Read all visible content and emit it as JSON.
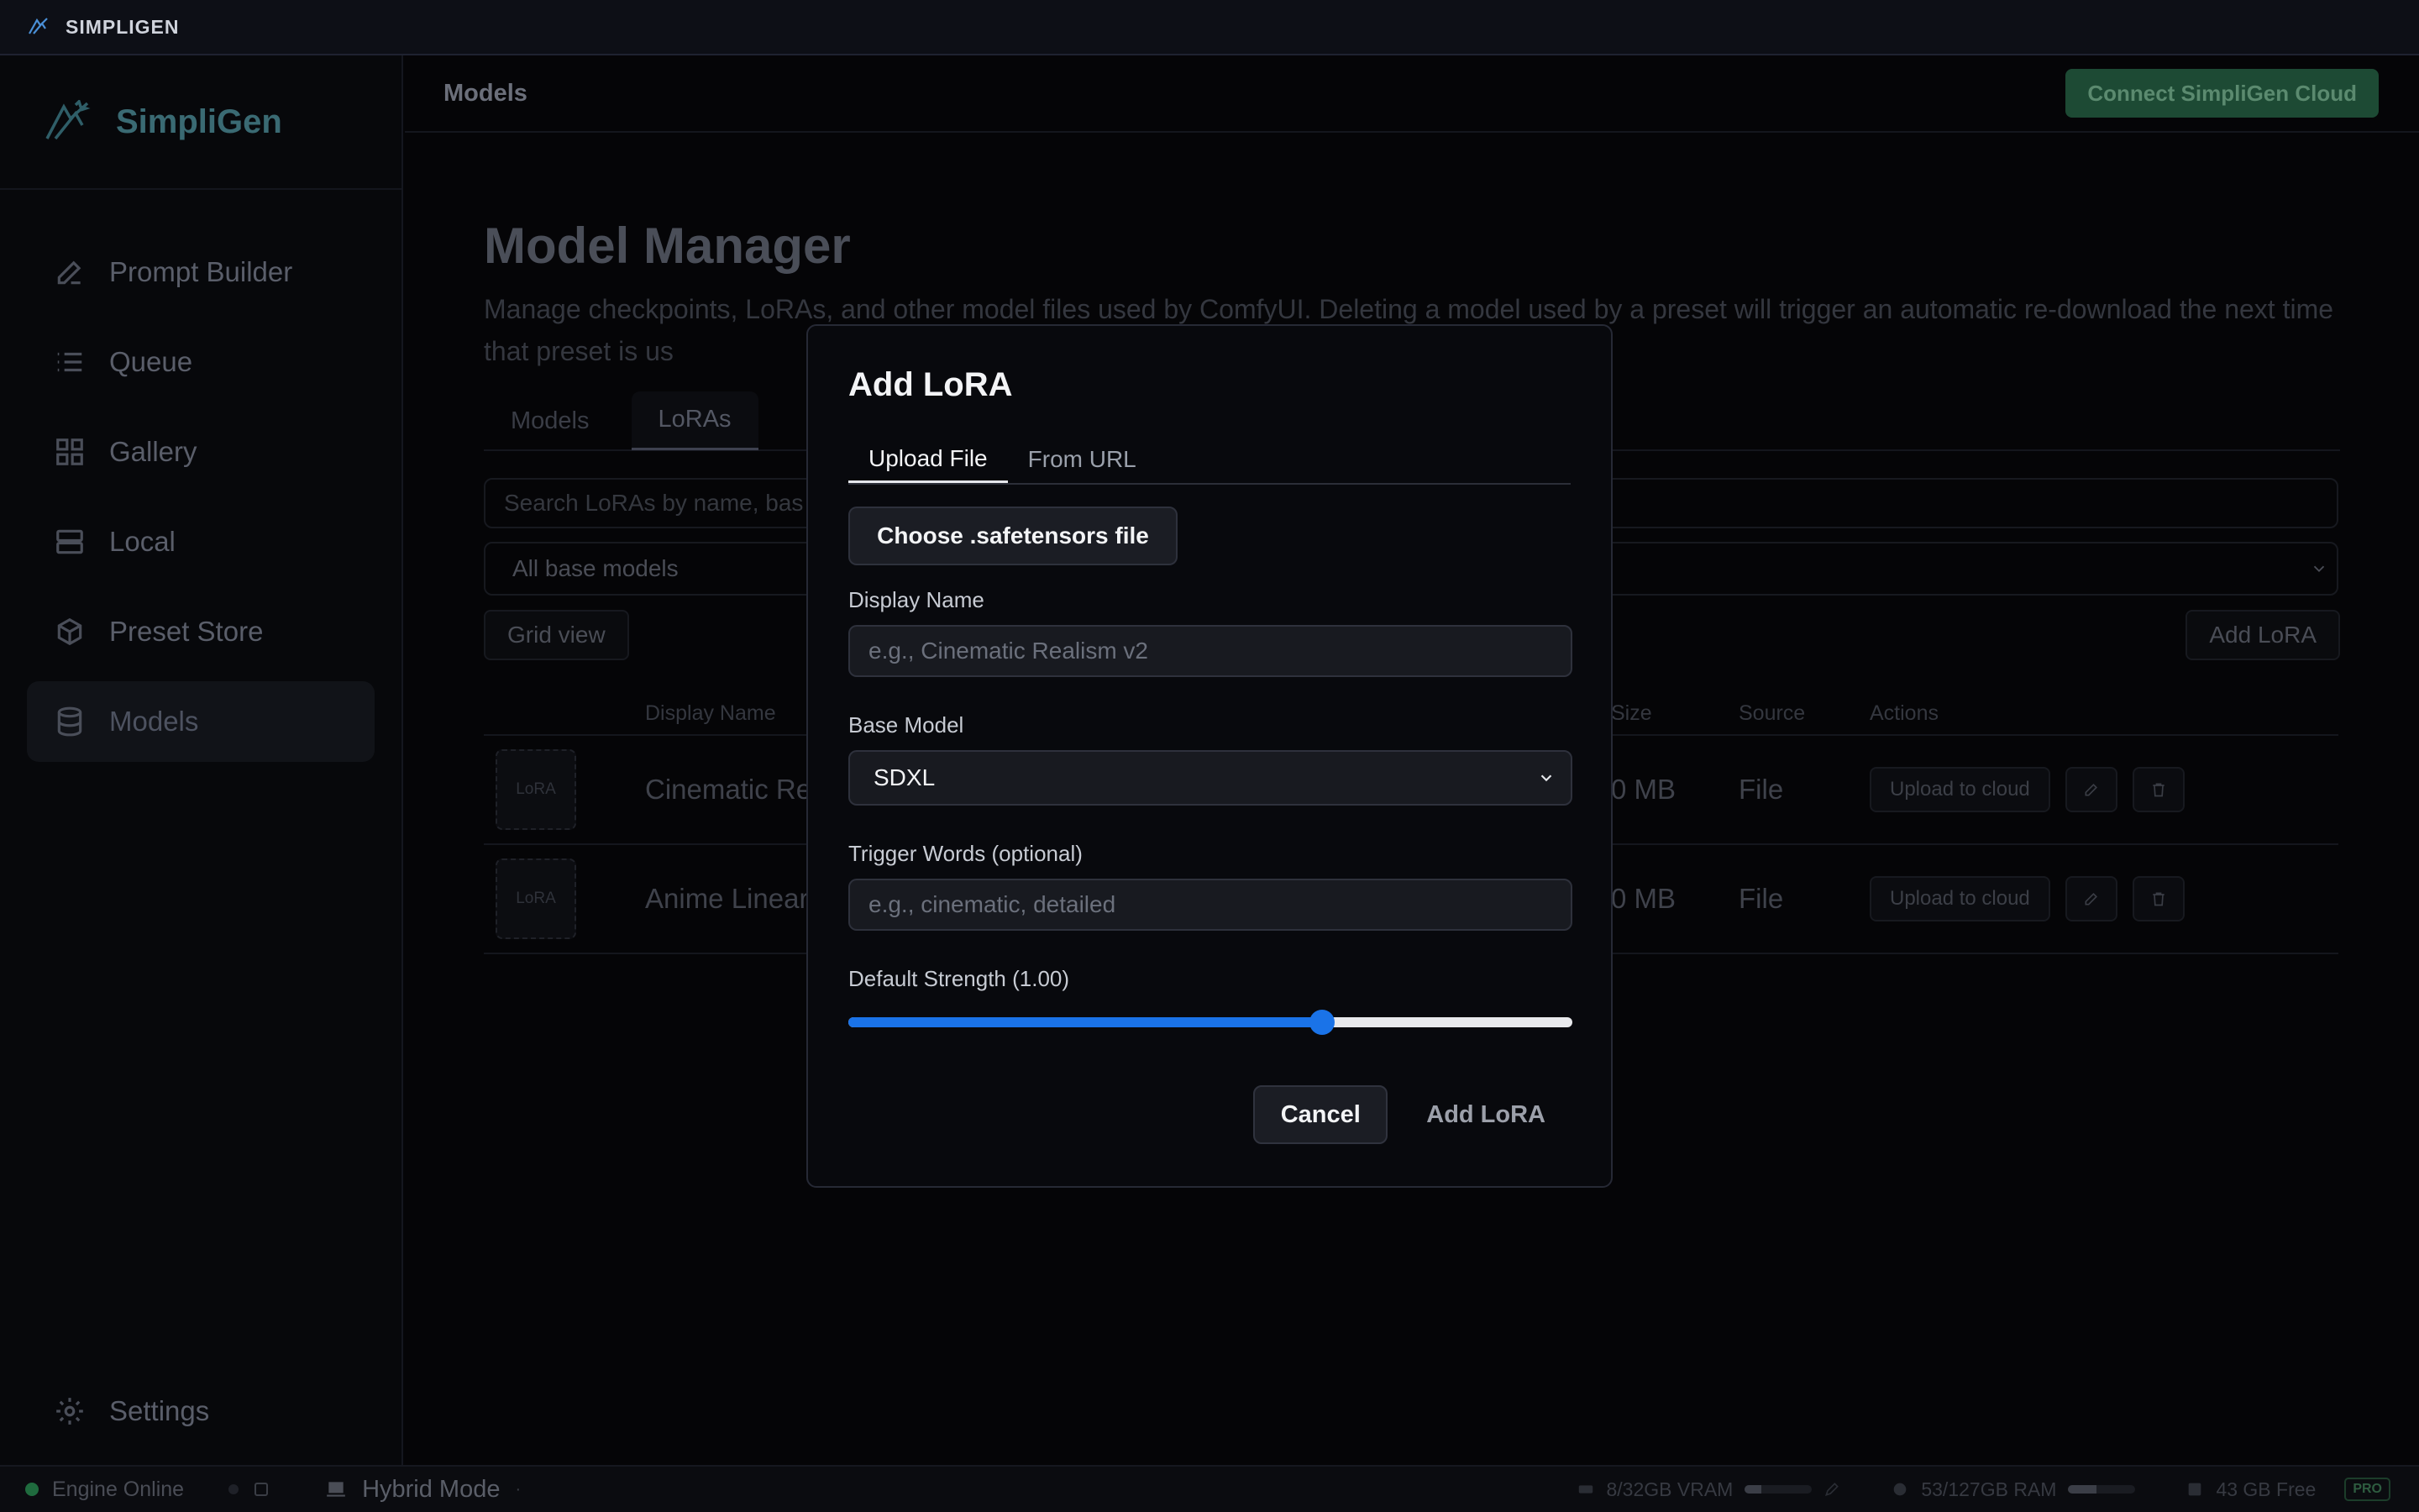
{
  "app": {
    "titlebar_name": "SIMPLIGEN",
    "brand_name": "SimpliGen"
  },
  "sidebar": {
    "items": [
      {
        "label": "Prompt Builder",
        "icon": "pencil-icon"
      },
      {
        "label": "Queue",
        "icon": "list-icon"
      },
      {
        "label": "Gallery",
        "icon": "grid-icon"
      },
      {
        "label": "Local",
        "icon": "server-icon"
      },
      {
        "label": "Preset Store",
        "icon": "package-icon"
      },
      {
        "label": "Models",
        "icon": "database-icon",
        "active": true
      }
    ],
    "settings_label": "Settings"
  },
  "header": {
    "crumb": "Models",
    "cloud_button": "Connect SimpliGen Cloud"
  },
  "main": {
    "title": "Model Manager",
    "description": "Manage checkpoints, LoRAs, and other model files used by ComfyUI. Deleting a model used by a preset will trigger an automatic re-download the next time that preset is us",
    "tabs": [
      "Models",
      "LoRAs"
    ],
    "active_tab": "LoRAs",
    "search_placeholder": "Search LoRAs by name, bas",
    "filter_value": "All base models",
    "grid_view_label": "Grid view",
    "add_lora_label": "Add LoRA",
    "columns": {
      "display_name": "Display Name",
      "size": "Size",
      "source": "Source",
      "actions": "Actions"
    },
    "rows": [
      {
        "thumb": "LoRA",
        "name": "Cinematic Re",
        "size": "0 MB",
        "source": "File",
        "upload": "Upload to cloud"
      },
      {
        "thumb": "LoRA",
        "name": "Anime Linear",
        "size": "0 MB",
        "source": "File",
        "upload": "Upload to cloud"
      }
    ]
  },
  "status": {
    "engine": "Engine Online",
    "mode": "Hybrid Mode",
    "vram": "8/32GB VRAM",
    "vram_fraction": 0.25,
    "ram": "53/127GB RAM",
    "ram_fraction": 0.42,
    "disk": "43 GB Free",
    "badge": "PRO"
  },
  "modal": {
    "title": "Add LoRA",
    "tabs": [
      "Upload File",
      "From URL"
    ],
    "active_tab": "Upload File",
    "choose_button": "Choose .safetensors file",
    "display_name_label": "Display Name",
    "display_name_placeholder": "e.g., Cinematic Realism v2",
    "base_model_label": "Base Model",
    "base_model_value": "SDXL",
    "trigger_label": "Trigger Words (optional)",
    "trigger_placeholder": "e.g., cinematic, detailed",
    "strength_label": "Default Strength (1.00)",
    "strength_fraction": 0.66,
    "cancel_button": "Cancel",
    "add_button": "Add LoRA"
  },
  "colors": {
    "accent": "#1a73e8",
    "cloud_button_bg": "#1d4a34",
    "online": "#1f6b3e"
  }
}
